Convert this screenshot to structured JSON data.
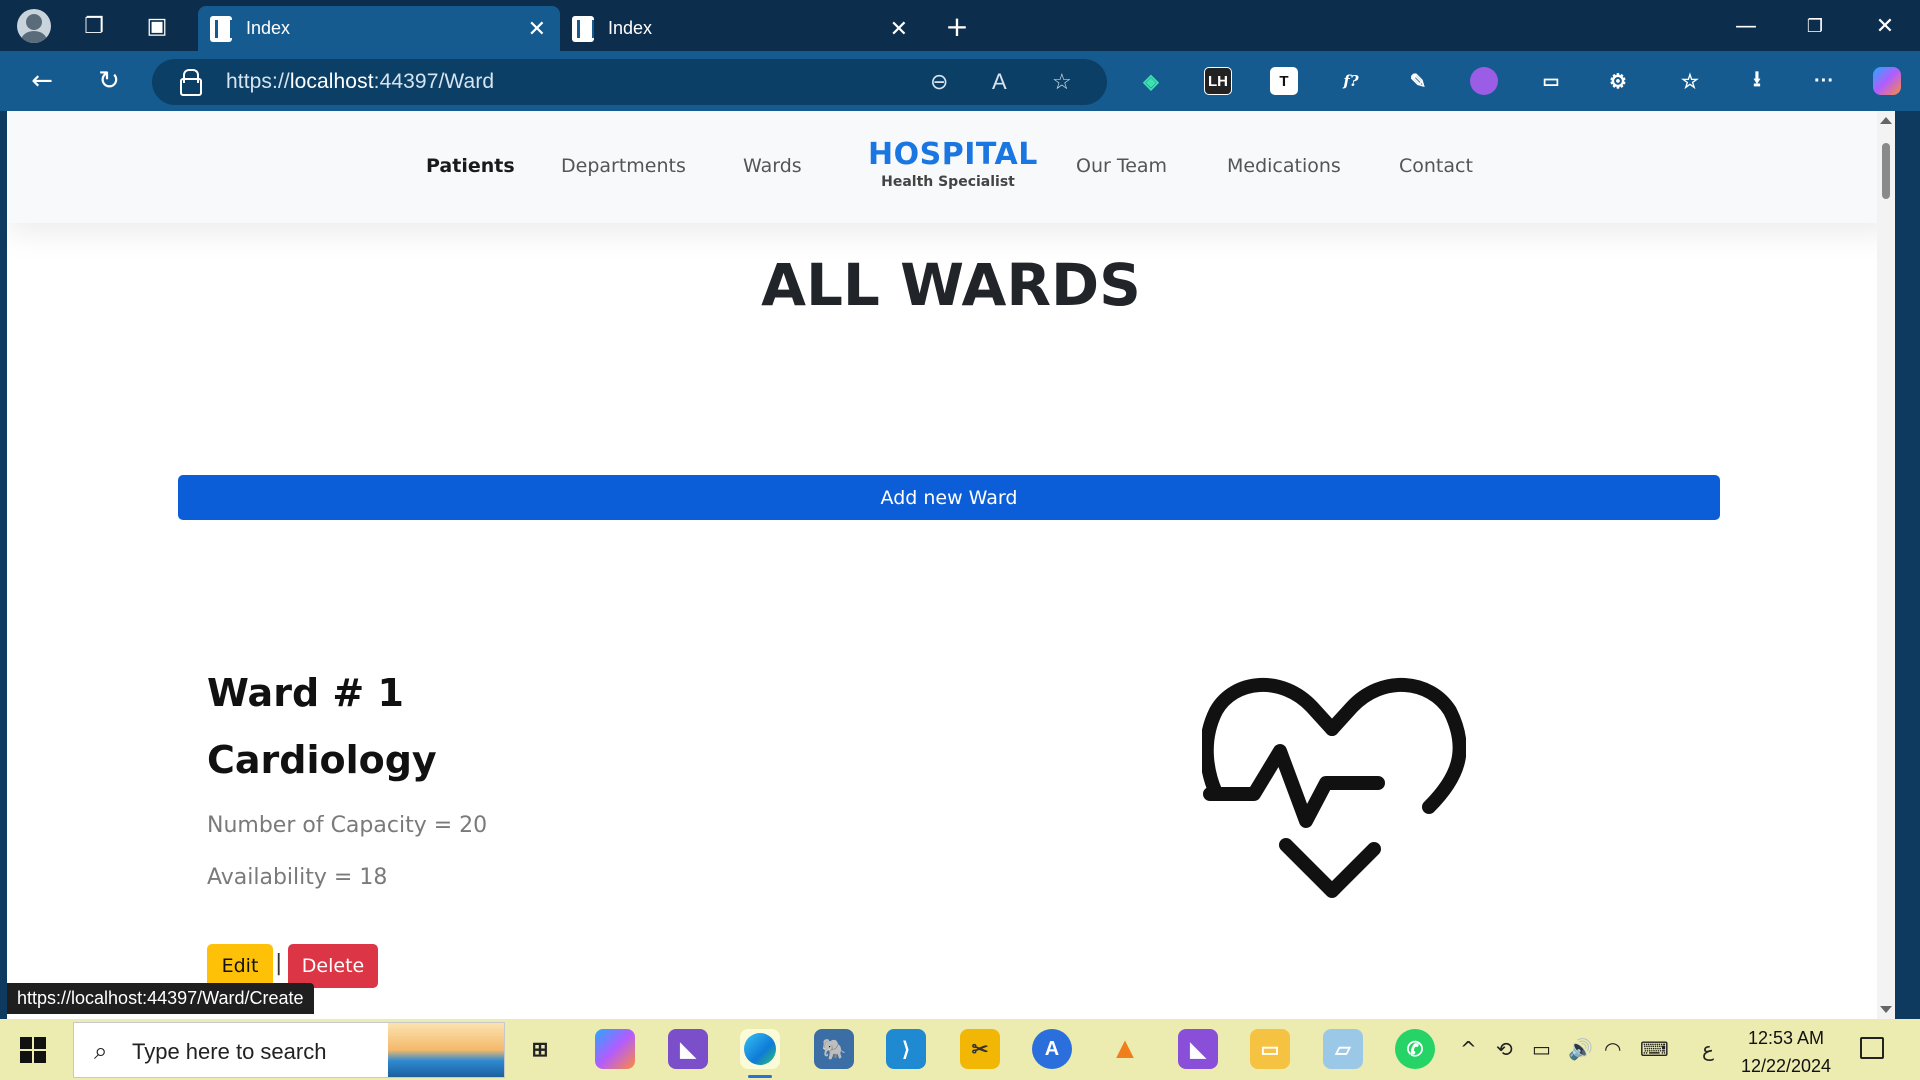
{
  "browser": {
    "tabs": [
      {
        "title": "Index",
        "active": true
      },
      {
        "title": "Index",
        "active": false
      }
    ],
    "address": {
      "scheme": "https://",
      "host": "localhost",
      "rest": ":44397/Ward"
    },
    "status_url": "https://localhost:44397/Ward/Create"
  },
  "site": {
    "brand": {
      "name": "HOSPITAL",
      "tagline": "Health Specialist"
    },
    "menu_left": [
      "Patients",
      "Departments",
      "Wards"
    ],
    "menu_right": [
      "Our Team",
      "Medications",
      "Contact"
    ],
    "active_menu": "Patients"
  },
  "page": {
    "title": "ALL WARDS",
    "add_button": "Add new Ward",
    "ward": {
      "number_label": "Ward # 1",
      "name": "Cardiology",
      "capacity_label": "Number of Capacity = 20",
      "availability_label": "Availability = 18",
      "edit_label": "Edit",
      "separator": "|",
      "delete_label": "Delete",
      "icon": "heart-pulse-icon"
    }
  },
  "taskbar": {
    "search_placeholder": "Type here to search",
    "time": "12:53 AM",
    "date": "12/22/2024",
    "lang": "ع"
  },
  "colors": {
    "primary": "#0b5ed7",
    "brand": "#1a76e0",
    "edit": "#ffc107",
    "delete": "#dc3545",
    "titlebar": "#0c2d4b",
    "toolbar": "#155b8f",
    "taskbar": "#ecebb0"
  }
}
